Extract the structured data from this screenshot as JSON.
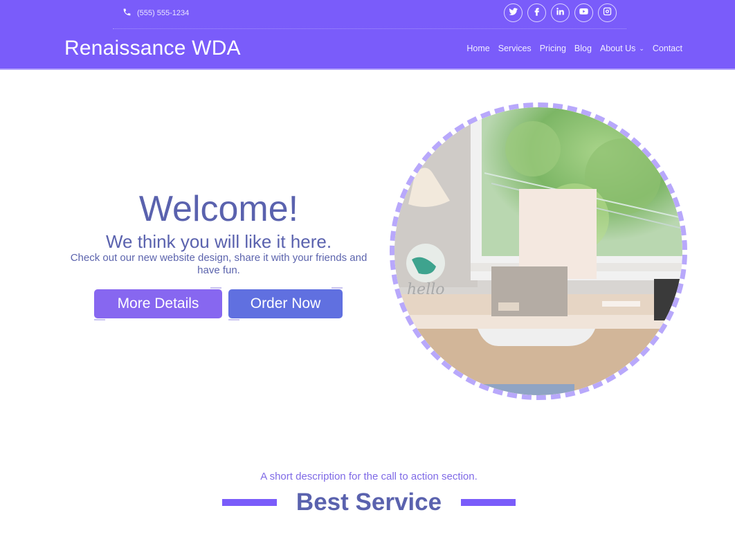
{
  "header": {
    "phone": "(555) 555-1234",
    "brand": "Renaissance WDA",
    "socials": [
      {
        "icon": "twitter-icon"
      },
      {
        "icon": "facebook-icon"
      },
      {
        "icon": "linkedin-icon"
      },
      {
        "icon": "youtube-icon"
      },
      {
        "icon": "instagram-icon"
      }
    ],
    "nav": [
      {
        "label": "Home"
      },
      {
        "label": "Services"
      },
      {
        "label": "Pricing"
      },
      {
        "label": "Blog"
      },
      {
        "label": "About Us",
        "dropdown": true
      },
      {
        "label": "Contact"
      }
    ]
  },
  "hero": {
    "title": "Welcome!",
    "subtitle": "We think you will like it here.",
    "description": "Check out our new website design, share it with your friends and have fun.",
    "buttons": {
      "more": "More Details",
      "order": "Order Now"
    }
  },
  "cta": {
    "description": "A short description for the call to action section.",
    "title": "Best Service"
  },
  "colors": {
    "brand": "#7a5cfa",
    "heading": "#5a62ae",
    "button_more": "#8767f0",
    "button_order": "#6070e0",
    "dash_border": "#b8a8fb"
  }
}
